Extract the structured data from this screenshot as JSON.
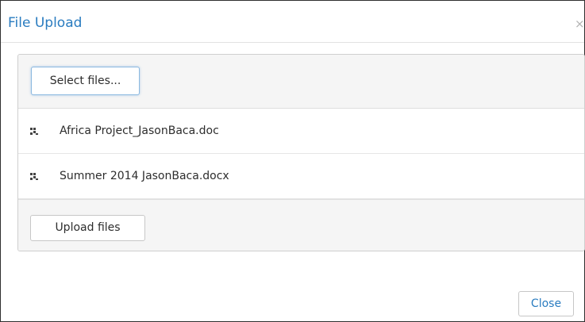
{
  "dialog": {
    "title": "File Upload",
    "close_glyph": "×",
    "close_button_label": "Close"
  },
  "upload": {
    "select_label": "Select files...",
    "upload_label": "Upload files",
    "files": [
      {
        "name": "Africa Project_JasonBaca.doc",
        "icon": "file-grip-icon"
      },
      {
        "name": "Summer 2014 JasonBaca.docx",
        "icon": "file-grip-icon"
      }
    ]
  },
  "colors": {
    "accent": "#2a7cc0",
    "panel_bg": "#f5f5f5"
  }
}
